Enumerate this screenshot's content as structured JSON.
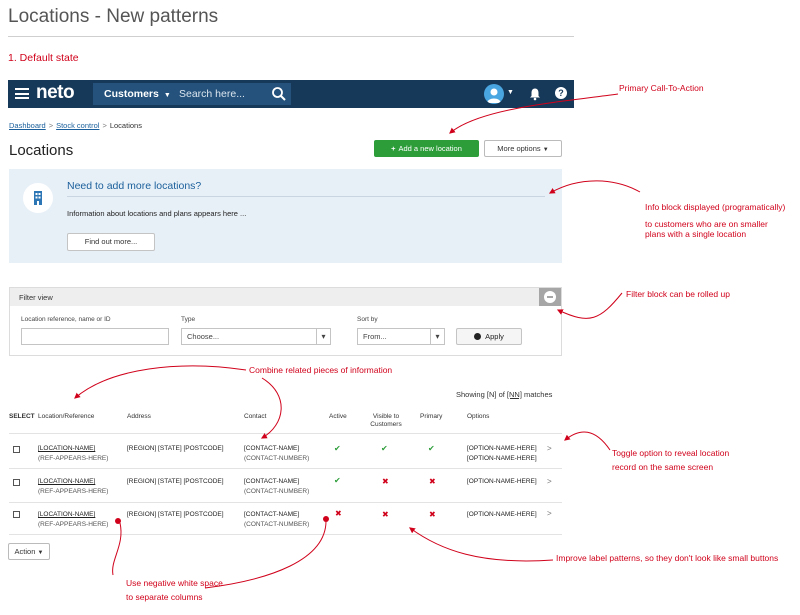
{
  "page": {
    "title": "Locations - New patterns",
    "section": "1. Default state"
  },
  "navbar": {
    "logo": "neto",
    "search_scope": "Customers",
    "search_placeholder": "Search here...",
    "bg_color": "#16395a"
  },
  "breadcrumb": [
    "Dashboard",
    "Stock control",
    "Locations"
  ],
  "header": {
    "title": "Locations",
    "primary_button": "Add a new location",
    "more_button": "More options"
  },
  "info_block": {
    "title": "Need to add more locations?",
    "description": "Information about locations and plans appears here ...",
    "button": "Find out more..."
  },
  "filter": {
    "title": "Filter view",
    "location_label": "Location reference, name or ID",
    "location_value": "",
    "type_label": "Type",
    "type_value": "Choose...",
    "sort_label": "Sort by",
    "sort_value": "From...",
    "apply_button": "Apply"
  },
  "results": {
    "showing_prefix": "Showing",
    "n": "[N]",
    "of": "of",
    "nn": "[NN]",
    "suffix": "matches"
  },
  "table": {
    "headers": {
      "select": "SELECT",
      "location": "Location/Reference",
      "address": "Address",
      "contact": "Contact",
      "active": "Active",
      "visible": "Visible to Customers",
      "primary": "Primary",
      "options": "Options"
    },
    "rows": [
      {
        "name": "[LOCATION-NAME]",
        "ref": "(REF-APPEARS-HERE)",
        "address": "[REGION] [STATE] [POSTCODE]",
        "contact_name": "[CONTACT-NAME]",
        "contact_number": "(CONTACT-NUMBER)",
        "active": true,
        "visible": true,
        "primary": true,
        "option1": "[OPTION-NAME-HERE]",
        "option2": "[OPTION-NAME-HERE]"
      },
      {
        "name": "[LOCATION-NAME]",
        "ref": "(REF-APPEARS-HERE)",
        "address": "[REGION] [STATE] [POSTCODE]",
        "contact_name": "[CONTACT-NAME]",
        "contact_number": "(CONTACT-NUMBER)",
        "active": true,
        "visible": false,
        "primary": false,
        "option1": "[OPTION-NAME-HERE]",
        "option2": ""
      },
      {
        "name": "[LOCATION-NAME]",
        "ref": "(REF-APPEARS-HERE)",
        "address": "[REGION] [STATE] [POSTCODE]",
        "contact_name": "[CONTACT-NAME]",
        "contact_number": "(CONTACT-NUMBER)",
        "active": false,
        "visible": false,
        "primary": false,
        "option1": "[OPTION-NAME-HERE]",
        "option2": ""
      }
    ]
  },
  "action_button": "Action",
  "annotations": {
    "cta": "Primary Call-To-Action",
    "info": [
      "Info block displayed (programatically)",
      "to customers who are on smaller",
      "plans with a single location"
    ],
    "filter": "Filter block can be rolled up",
    "combine": "Combine related pieces of information",
    "toggle": [
      "Toggle option to reveal location",
      "record on the same screen"
    ],
    "labels": "Improve label patterns, so they don't look like small buttons",
    "whitespace": [
      "Use negative white space",
      "to separate columns"
    ]
  },
  "colors": {
    "annotation": "#d0021b",
    "primary_button": "#2d9d3a",
    "info_bg": "#e8f0f7",
    "link": "#1a5f9b"
  },
  "icons": [
    "hamburger-icon",
    "search-icon",
    "avatar-icon",
    "bell-icon",
    "help-icon",
    "plus-icon",
    "caret-down-icon",
    "building-icon",
    "collapse-icon",
    "check-circle-icon",
    "checkmark-icon",
    "cross-icon",
    "chevron-right-icon"
  ]
}
